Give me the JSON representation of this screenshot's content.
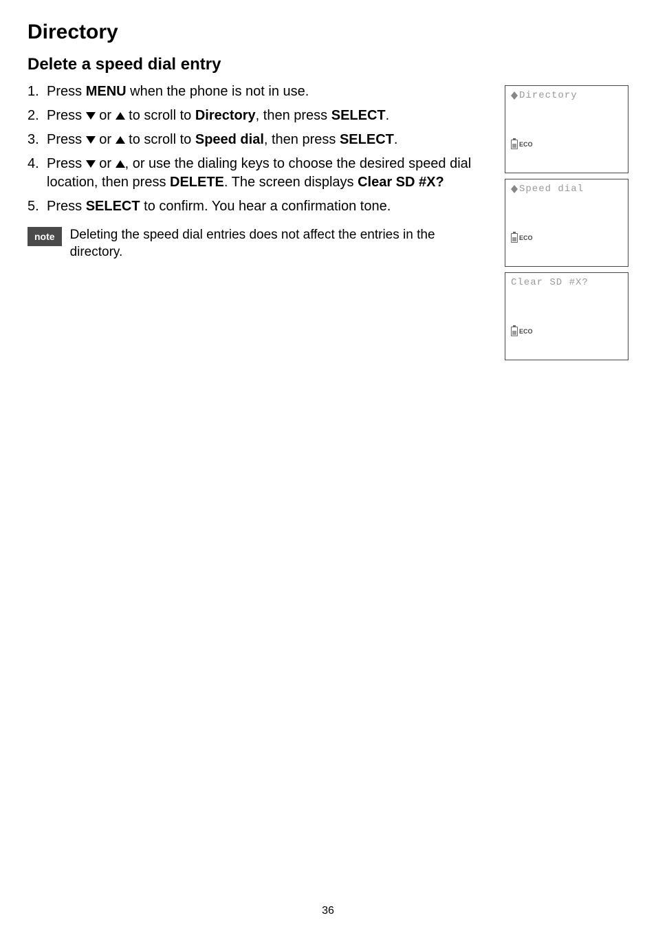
{
  "title": "Directory",
  "section_heading": "Delete a speed dial entry",
  "steps": {
    "s1": {
      "prefix": "Press ",
      "key1": "MENU",
      "suffix": " when the phone is not in use."
    },
    "s2": {
      "prefix": "Press ",
      "mid1": " or ",
      "mid2": " to scroll to ",
      "target": "Directory",
      "mid3": ", then press ",
      "key": "SELECT",
      "suffix": "."
    },
    "s3": {
      "prefix": "Press ",
      "mid1": " or ",
      "mid2": " to scroll to ",
      "target": "Speed dial",
      "mid3": ", then press ",
      "key": "SELECT",
      "suffix": "."
    },
    "s4": {
      "prefix": "Press ",
      "mid1": " or ",
      "mid2": ", or use the dialing keys to choose the desired speed dial location, then press ",
      "key": "DELETE",
      "mid3": ". The screen displays ",
      "prompt": "Clear SD #X?"
    },
    "s5": {
      "prefix": "Press ",
      "key": "SELECT",
      "suffix": " to confirm. You hear a confirmation tone."
    }
  },
  "note": {
    "label": "note",
    "text": "Deleting the speed dial entries does not affect the entries in the directory."
  },
  "screens": {
    "s1": {
      "text": "Directory",
      "eco": "ECO",
      "show_arrows": true
    },
    "s2": {
      "text": "Speed dial",
      "eco": "ECO",
      "show_arrows": true
    },
    "s3": {
      "text": "Clear SD #X?",
      "eco": "ECO",
      "show_arrows": false
    }
  },
  "page_number": "36"
}
